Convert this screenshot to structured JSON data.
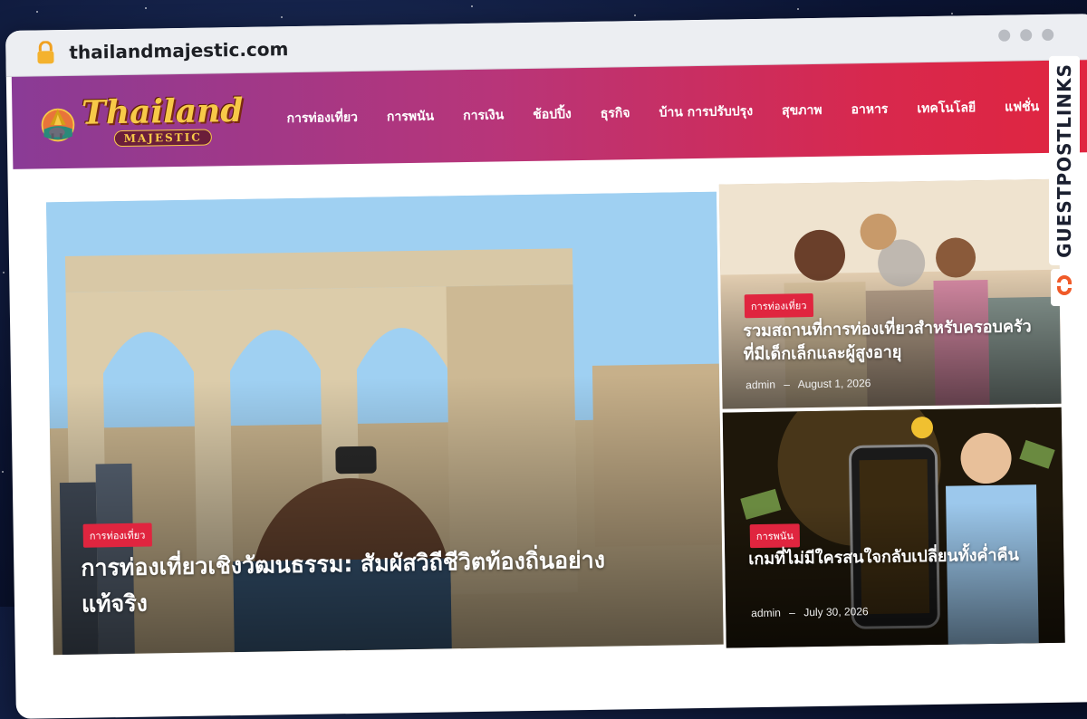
{
  "browser": {
    "url": "thailandmajestic.com"
  },
  "site": {
    "logo_title": "Thailand",
    "logo_subtitle": "MAJESTIC",
    "nav": [
      "การท่องเที่ยว",
      "การพนัน",
      "การเงิน",
      "ช้อปปิ้ง",
      "ธุรกิจ",
      "บ้าน การปรับปรุง",
      "สุขภาพ",
      "อาหาร",
      "เทคโนโลยี",
      "แฟชั่น"
    ]
  },
  "hero": {
    "category": "การท่องเที่ยว",
    "title": "การท่องเที่ยวเชิงวัฒนธรรม: สัมผัสวิถีชีวิตท้องถิ่นอย่างแท้จริง"
  },
  "cards": [
    {
      "category": "การท่องเที่ยว",
      "title": "รวมสถานที่การท่องเที่ยวสำหรับครอบครัวที่มีเด็กเล็กและผู้สูงอายุ",
      "author": "admin",
      "separator": "–",
      "date": "August 1, 2026"
    },
    {
      "category": "การพนัน",
      "title": "เกมที่ไม่มีใครสนใจกลับเปลี่ยนทั้งค่ำคืน",
      "author": "admin",
      "separator": "–",
      "date": "July 30, 2026"
    }
  ],
  "watermark": {
    "text": "GUESTPOSTLINKS",
    "icon": "link-icon"
  },
  "colors": {
    "header_start": "#8a3b96",
    "header_end": "#e0253f",
    "badge": "#e0253f",
    "logo_gold": "#f7c948"
  }
}
